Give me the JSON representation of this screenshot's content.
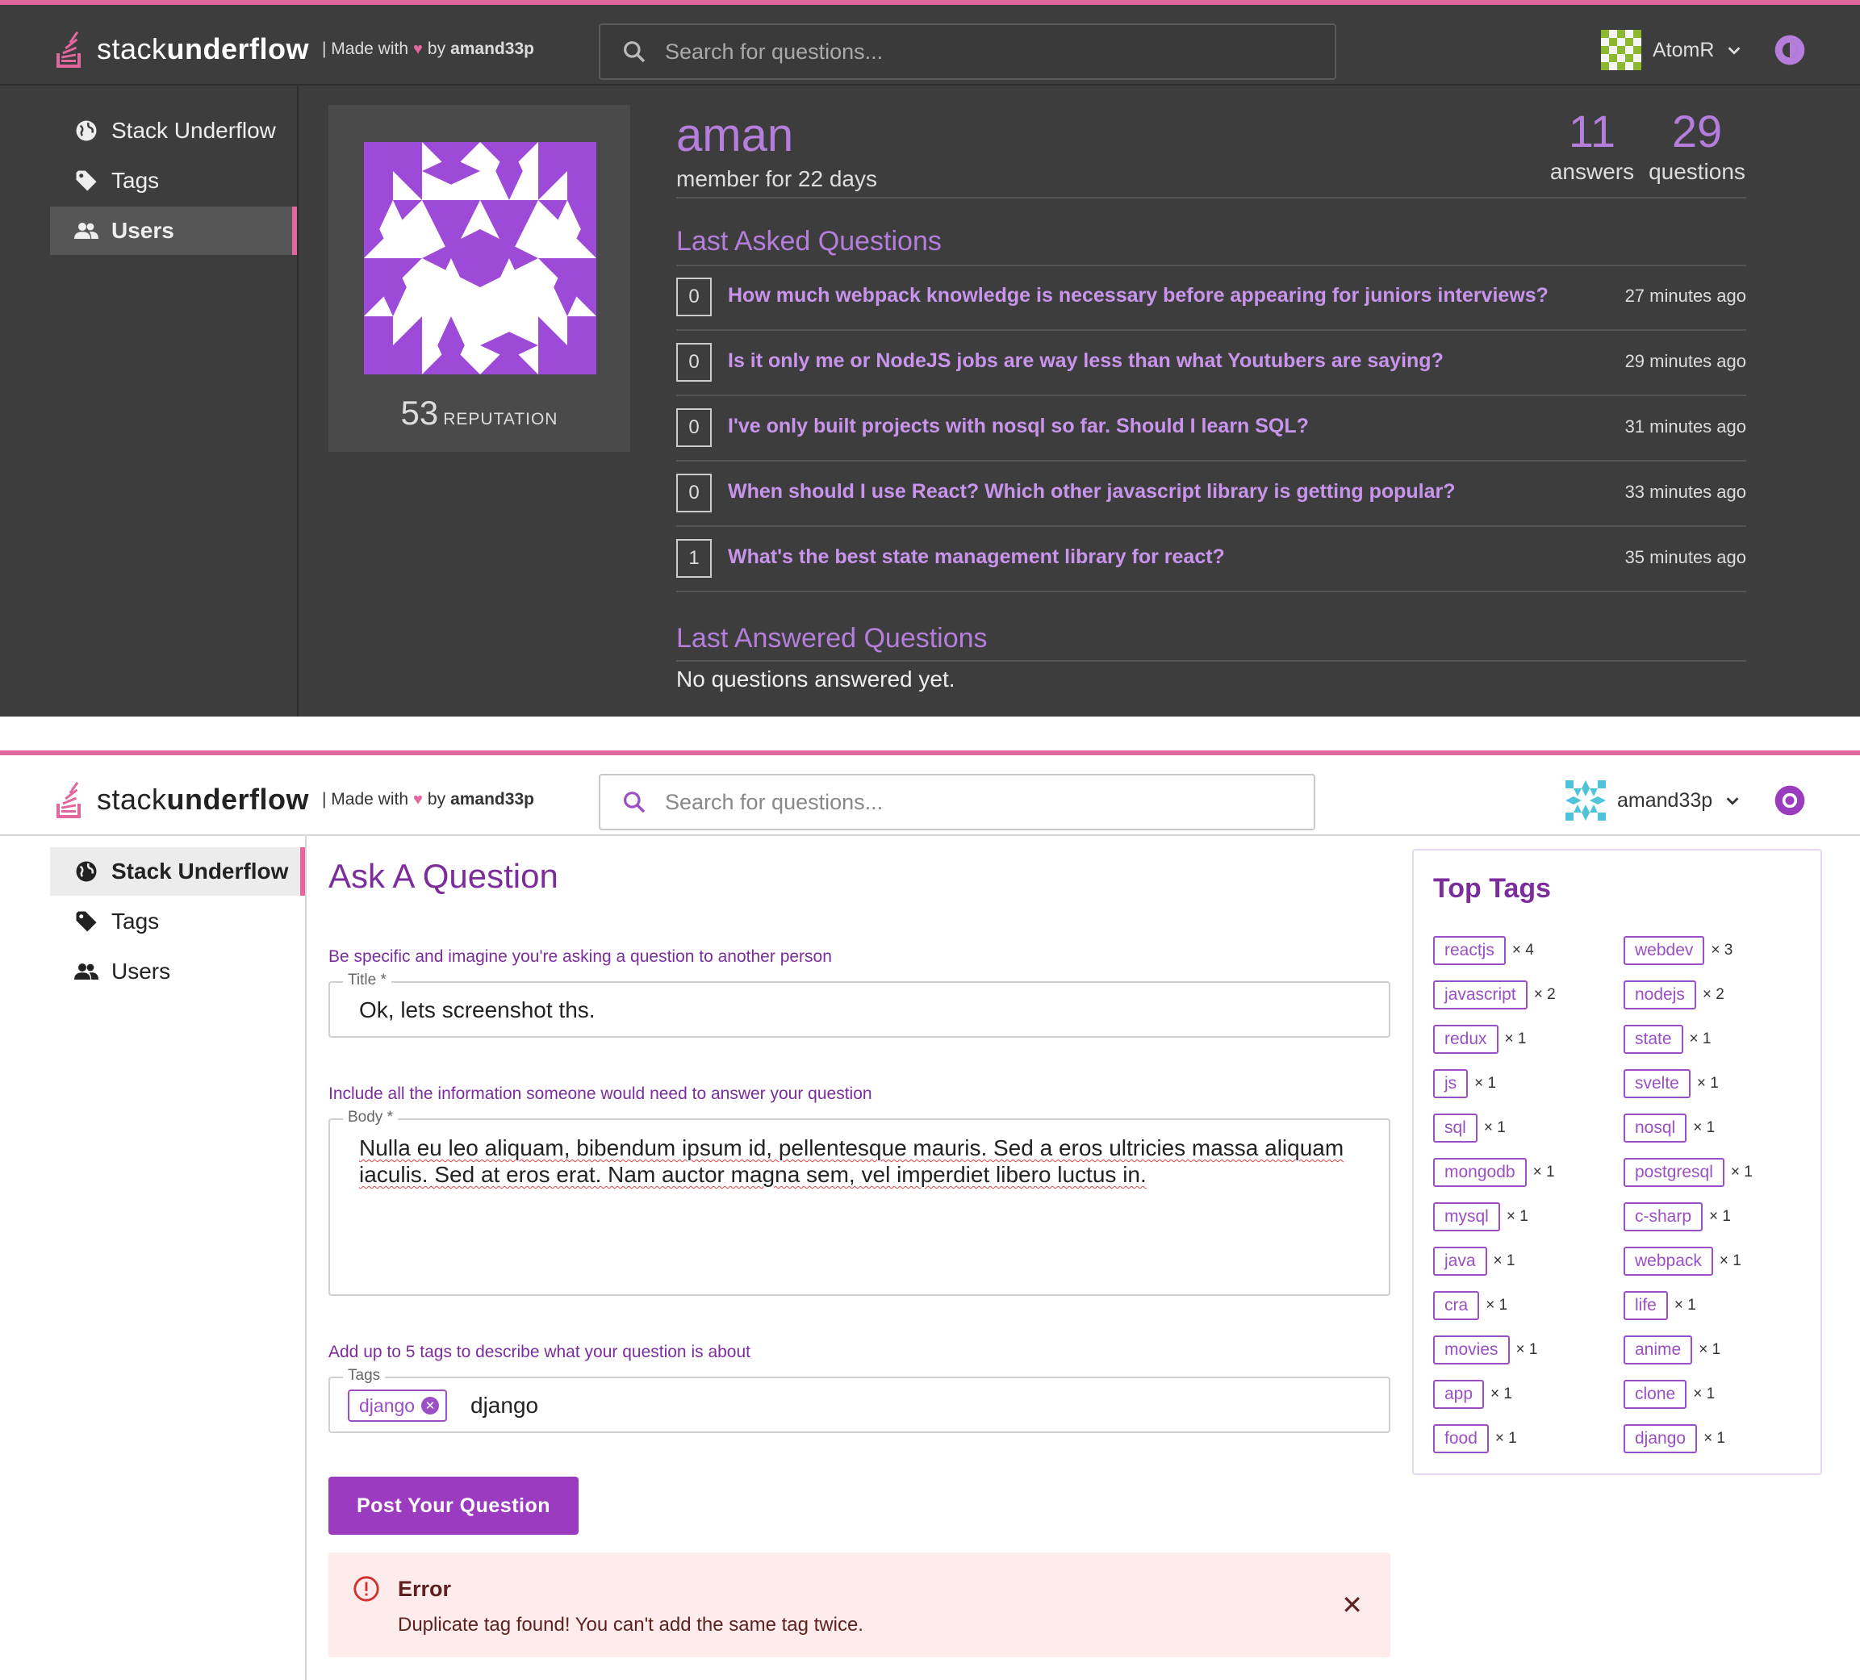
{
  "dark": {
    "logo": {
      "text_light": "stack",
      "text_bold": "underflow"
    },
    "made_with": {
      "prefix": "| Made with",
      "heart": "♥",
      "by": "by",
      "author": "amand33p"
    },
    "search": {
      "placeholder": "Search for questions..."
    },
    "user": {
      "name": "AtomR"
    },
    "sidebar": {
      "items": [
        {
          "label": "Stack Underflow",
          "icon": "globe-icon"
        },
        {
          "label": "Tags",
          "icon": "tag-icon"
        },
        {
          "label": "Users",
          "icon": "users-icon",
          "active": true
        }
      ]
    },
    "profile": {
      "username": "aman",
      "member_since": "member for 22 days",
      "reputation": "53",
      "reputation_label": "REPUTATION",
      "answers": "11",
      "answers_label": "answers",
      "questions": "29",
      "questions_label": "questions"
    },
    "last_asked": {
      "title": "Last Asked Questions",
      "items": [
        {
          "count": "0",
          "title": "How much webpack knowledge is necessary before appearing for juniors interviews?",
          "time": "27 minutes ago"
        },
        {
          "count": "0",
          "title": "Is it only me or NodeJS jobs are way less than what Youtubers are saying?",
          "time": "29 minutes ago"
        },
        {
          "count": "0",
          "title": "I've only built projects with nosql so far. Should I learn SQL?",
          "time": "31 minutes ago"
        },
        {
          "count": "0",
          "title": "When should I use React? Which other javascript library is getting popular?",
          "time": "33 minutes ago"
        },
        {
          "count": "1",
          "title": "What's the best state management library for react?",
          "time": "35 minutes ago"
        }
      ]
    },
    "last_answered": {
      "title": "Last Answered Questions",
      "empty": "No questions answered yet."
    }
  },
  "light": {
    "logo": {
      "text_light": "stack",
      "text_bold": "underflow"
    },
    "made_with": {
      "prefix": "| Made with",
      "heart": "♥",
      "by": "by",
      "author": "amand33p"
    },
    "search": {
      "placeholder": "Search for questions..."
    },
    "user": {
      "name": "amand33p"
    },
    "sidebar": {
      "items": [
        {
          "label": "Stack Underflow",
          "icon": "globe-icon",
          "active": true
        },
        {
          "label": "Tags",
          "icon": "tag-icon"
        },
        {
          "label": "Users",
          "icon": "users-icon"
        }
      ]
    },
    "form": {
      "heading": "Ask A Question",
      "title_hint": "Be specific and imagine you're asking a question to another person",
      "title_label": "Title *",
      "title_value": "Ok, lets screenshot ths.",
      "body_hint": "Include all the information someone would need to answer your question",
      "body_label": "Body *",
      "body_value": "Nulla eu leo aliquam, bibendum ipsum id, pellentesque mauris. Sed a eros ultricies massa aliquam iaculis. Sed at eros erat. Nam auctor magna sem, vel imperdiet libero luctus in.",
      "tags_hint": "Add up to 5 tags to describe what your question is about",
      "tags_label": "Tags",
      "tag_chip": "django",
      "tags_input": "django",
      "submit": "Post Your Question"
    },
    "error": {
      "title": "Error",
      "message": "Duplicate tag found! You can't add the same tag twice."
    },
    "top_tags": {
      "title": "Top Tags",
      "left": [
        {
          "name": "reactjs",
          "count": "× 4"
        },
        {
          "name": "javascript",
          "count": "× 2"
        },
        {
          "name": "redux",
          "count": "× 1"
        },
        {
          "name": "js",
          "count": "× 1"
        },
        {
          "name": "sql",
          "count": "× 1"
        },
        {
          "name": "mongodb",
          "count": "× 1"
        },
        {
          "name": "mysql",
          "count": "× 1"
        },
        {
          "name": "java",
          "count": "× 1"
        },
        {
          "name": "cra",
          "count": "× 1"
        },
        {
          "name": "movies",
          "count": "× 1"
        },
        {
          "name": "app",
          "count": "× 1"
        },
        {
          "name": "food",
          "count": "× 1"
        }
      ],
      "right": [
        {
          "name": "webdev",
          "count": "× 3"
        },
        {
          "name": "nodejs",
          "count": "× 2"
        },
        {
          "name": "state",
          "count": "× 1"
        },
        {
          "name": "svelte",
          "count": "× 1"
        },
        {
          "name": "nosql",
          "count": "× 1"
        },
        {
          "name": "postgresql",
          "count": "× 1"
        },
        {
          "name": "c-sharp",
          "count": "× 1"
        },
        {
          "name": "webpack",
          "count": "× 1"
        },
        {
          "name": "life",
          "count": "× 1"
        },
        {
          "name": "anime",
          "count": "× 1"
        },
        {
          "name": "clone",
          "count": "× 1"
        },
        {
          "name": "django",
          "count": "× 1"
        }
      ]
    }
  },
  "colors": {
    "accent": "#e1679c",
    "purple": "#9b3cc0",
    "purple_text": "#b57edc"
  }
}
